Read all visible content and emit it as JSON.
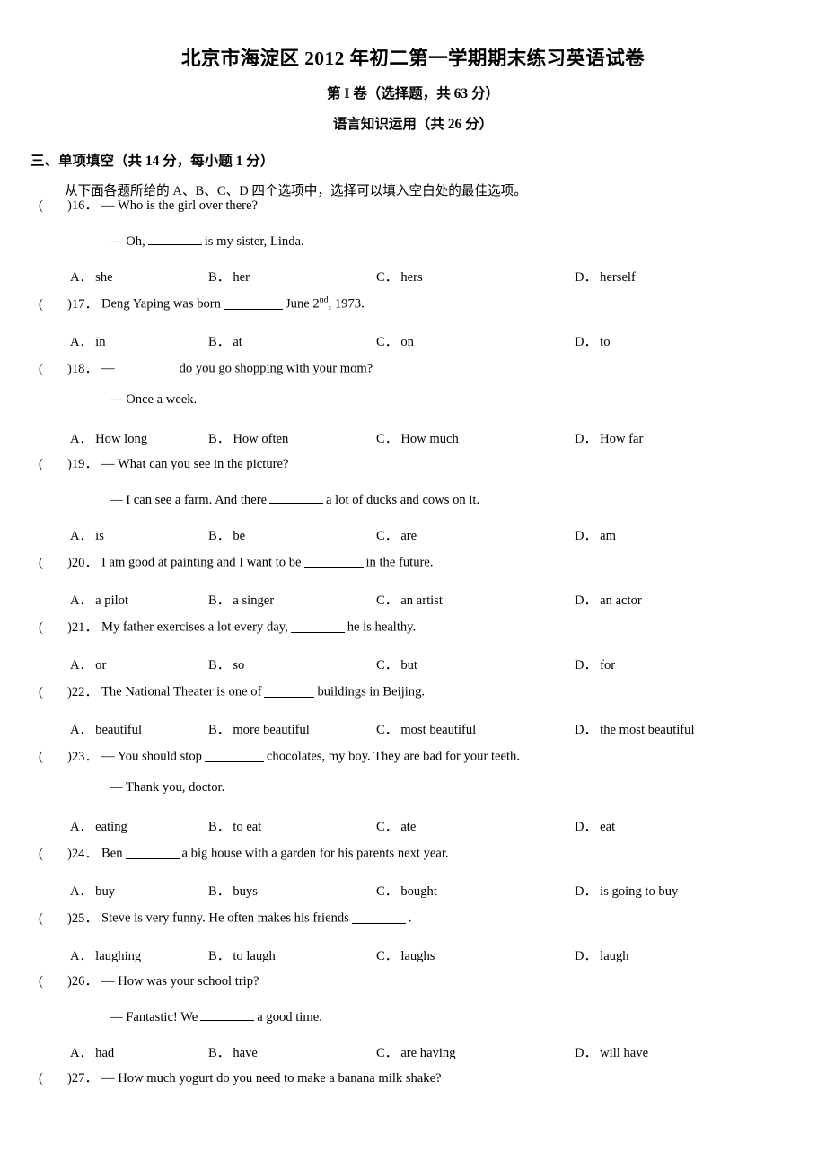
{
  "document": {
    "title": "北京市海淀区 2012 年初二第一学期期末练习英语试卷",
    "subheading_1": "第 I 卷（选择题，共 63 分）",
    "subheading_2": "语言知识运用（共 26 分）",
    "section_heading": "三、单项填空（共 14 分，每小题 1 分）",
    "instruction": "从下面各题所给的 A、B、C、D 四个选项中，选择可以填入空白处的最佳选项。"
  },
  "marks": {
    "open_paren": "(",
    "close_paren": ")",
    "dash": "—"
  },
  "questions": [
    {
      "number": "16",
      "line1": "— Who is the girl over there?",
      "line2_pre": "— Oh,",
      "line2_post": "is my sister, Linda.",
      "blank": true,
      "options": {
        "a": "she",
        "b": "her",
        "c": "hers",
        "d": "herself"
      }
    },
    {
      "number": "17",
      "line1_pre": "Deng Yaping was born",
      "line1_post": "June 2",
      "line1_sup": "nd",
      "line1_tail": ", 1973.",
      "options": {
        "a": "in",
        "b": "at",
        "c": "on",
        "d": "to"
      }
    },
    {
      "number": "18",
      "line1_pre": "—",
      "line1_post": "do you go shopping with your mom?",
      "line2": "— Once a week.",
      "options": {
        "a": "How long",
        "b": "How often",
        "c": "How much",
        "d": "How far"
      }
    },
    {
      "number": "19",
      "line1": "— What can you see in the picture?",
      "line2_pre": "— I can see a farm. And there",
      "line2_post": "a lot of ducks and cows on it.",
      "options": {
        "a": "is",
        "b": "be",
        "c": "are",
        "d": "am"
      }
    },
    {
      "number": "20",
      "line1_pre": "I am good at painting and I want to be",
      "line1_post": "in the future.",
      "options": {
        "a": "a pilot",
        "b": "a singer",
        "c": "an artist",
        "d": "an actor"
      }
    },
    {
      "number": "21",
      "line1_pre": "My father exercises a lot every day,",
      "line1_post": "he is healthy.",
      "options": {
        "a": "or",
        "b": "so",
        "c": "but",
        "d": "for"
      }
    },
    {
      "number": "22",
      "line1_pre": "The National Theater is one of",
      "line1_post": "buildings in Beijing.",
      "options": {
        "a": "beautiful",
        "b": "more beautiful",
        "c": "most beautiful",
        "d": "the most beautiful"
      }
    },
    {
      "number": "23",
      "line1_pre": "— You should stop",
      "line1_post": "chocolates, my boy. They are bad for your teeth.",
      "line2": "— Thank you, doctor.",
      "options": {
        "a": "eating",
        "b": "to eat",
        "c": "ate",
        "d": "eat"
      }
    },
    {
      "number": "24",
      "line1_pre": "Ben",
      "line1_post": "a big house with a garden for his parents next year.",
      "options": {
        "a": "buy",
        "b": "buys",
        "c": "bought",
        "d": "is going to buy"
      }
    },
    {
      "number": "25",
      "line1_pre": "Steve is very funny. He often makes his friends",
      "line1_post": ".",
      "options": {
        "a": "laughing",
        "b": "to laugh",
        "c": "laughs",
        "d": "laugh"
      }
    },
    {
      "number": "26",
      "line1": "— How was your school trip?",
      "line2_pre": "— Fantastic! We",
      "line2_post": "a good time.",
      "options": {
        "a": "had",
        "b": "have",
        "c": "are having",
        "d": "will have"
      }
    },
    {
      "number": "27",
      "line1": "— How much yogurt do you need to make a banana milk shake?"
    }
  ]
}
